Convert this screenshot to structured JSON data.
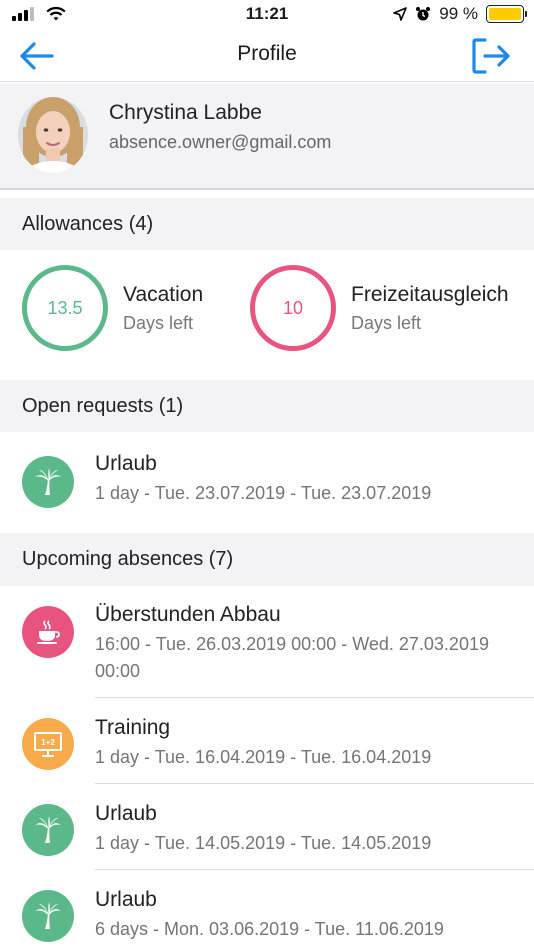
{
  "status_bar": {
    "time": "11:21",
    "battery_percent": "99 %",
    "battery_level": 0.99,
    "icons": [
      "signal-icon",
      "wifi-icon",
      "location-icon",
      "alarm-icon",
      "battery-icon"
    ]
  },
  "nav": {
    "title": "Profile",
    "back_icon": "back-arrow-icon",
    "logout_icon": "logout-icon",
    "accent_color": "#1e88e5"
  },
  "profile": {
    "name": "Chrystina Labbe",
    "email": "absence.owner@gmail.com"
  },
  "allowances": {
    "header": "Allowances (4)",
    "items": [
      {
        "value": "13.5",
        "title": "Vacation",
        "subtitle": "Days left",
        "color": "#5bb88a"
      },
      {
        "value": "10",
        "title": "Freizeitausgleich",
        "subtitle": "Days left",
        "color": "#e8547f"
      }
    ]
  },
  "open_requests": {
    "header": "Open requests (1)",
    "items": [
      {
        "title": "Urlaub",
        "subtitle": "1 day - Tue. 23.07.2019 - Tue. 23.07.2019",
        "icon": "palm-tree-icon",
        "color": "#5bb88a"
      }
    ]
  },
  "upcoming": {
    "header": "Upcoming absences (7)",
    "items": [
      {
        "title": "Überstunden Abbau",
        "subtitle": "16:00 - Tue. 26.03.2019 00:00 - Wed. 27.03.2019 00:00",
        "icon": "coffee-cup-icon",
        "color": "#e8547f"
      },
      {
        "title": "Training",
        "subtitle": "1 day - Tue. 16.04.2019 - Tue. 16.04.2019",
        "icon": "training-board-icon",
        "icon_text": "1+2",
        "color": "#f7ab4d"
      },
      {
        "title": "Urlaub",
        "subtitle": "1 day - Tue. 14.05.2019 - Tue. 14.05.2019",
        "icon": "palm-tree-icon",
        "color": "#5bb88a"
      },
      {
        "title": "Urlaub",
        "subtitle": "6 days - Mon. 03.06.2019 - Tue. 11.06.2019",
        "icon": "palm-tree-icon",
        "color": "#5bb88a"
      }
    ]
  }
}
